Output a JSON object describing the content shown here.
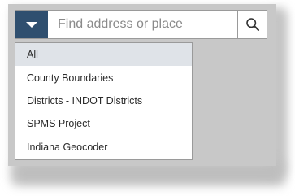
{
  "search": {
    "placeholder": "Find address or place",
    "value": ""
  },
  "icons": {
    "toggle": "caret-down-icon",
    "search": "search-icon"
  },
  "colors": {
    "toggle_bg": "#2f4f6f",
    "selected_bg": "#dfe3e8"
  },
  "dropdown": {
    "selected": "All",
    "items": [
      {
        "label": "All"
      },
      {
        "label": "County Boundaries"
      },
      {
        "label": "Districts - INDOT Districts"
      },
      {
        "label": "SPMS Project"
      },
      {
        "label": "Indiana Geocoder"
      }
    ]
  }
}
